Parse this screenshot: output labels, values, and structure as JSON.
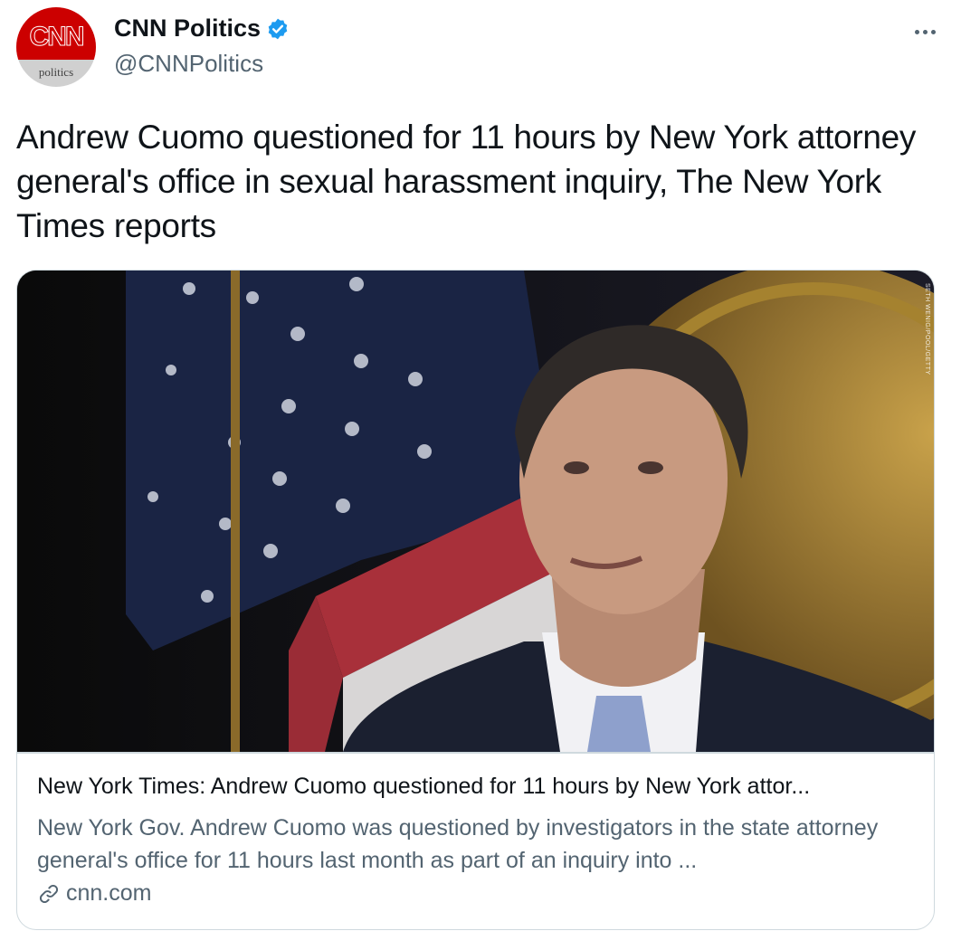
{
  "author": {
    "avatar_logo": "CNN",
    "avatar_sub": "politics",
    "display_name": "CNN Politics",
    "handle": "@CNNPolitics",
    "verified": true
  },
  "tweet": {
    "text": "Andrew Cuomo questioned for 11 hours by New York attorney general's office in sexual harassment inquiry, The New York Times reports"
  },
  "card": {
    "title": "New York Times: Andrew Cuomo questioned for 11 hours by New York attor...",
    "description": "New York Gov. Andrew Cuomo was questioned by investigators in the state attorney general's office for 11 hours last month as part of an inquiry into ...",
    "domain": "cnn.com",
    "photo_credit": "SETH WENIG/POOL/GETTY"
  },
  "icons": {
    "verified": "verified-badge-icon",
    "more": "more-options-icon",
    "link": "link-icon"
  },
  "colors": {
    "brand_red": "#cc0000",
    "verified_blue": "#1d9bf0",
    "secondary_text": "#536471",
    "border": "#cfd9de"
  }
}
